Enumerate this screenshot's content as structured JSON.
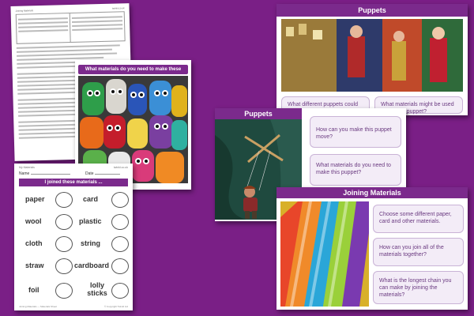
{
  "lesson_plan": {
    "heading": "Joining Materials",
    "sheet_tag": "twinkl.co.uk"
  },
  "puppet_sheet": {
    "title": "What materials do you need to make these puppets?"
  },
  "materials_sheet": {
    "header_left": "My Materials",
    "header_right": "twinkl.co.uk",
    "name_label": "Name",
    "date_label": "Date",
    "title": "I joined these materials ...",
    "items": [
      "paper",
      "card",
      "wool",
      "plastic",
      "cloth",
      "string",
      "straw",
      "cardboard",
      "foil",
      "lolly sticks"
    ],
    "footer_left": "Joining Materials — Materials Sheet",
    "footer_right": "© Copyright Twinkl Ltd"
  },
  "slide_puppets": {
    "title": "Puppets",
    "questions": [
      "What different puppets could you see?",
      "What materials might be used to make a puppet?"
    ]
  },
  "slide_puppet_move": {
    "title": "Puppets",
    "questions": [
      "How can you make this puppet move?",
      "What materials do you need to make this puppet?"
    ]
  },
  "slide_joining": {
    "title": "Joining Materials",
    "questions": [
      "Choose some different paper, card and other materials.",
      "How can you join all of the materials together?",
      "What is the longest chain you can make by joining the materials?"
    ]
  },
  "colors": {
    "background": "#7a1f86",
    "accent": "#7b2a8c",
    "box_fill": "#f3ecf7"
  }
}
